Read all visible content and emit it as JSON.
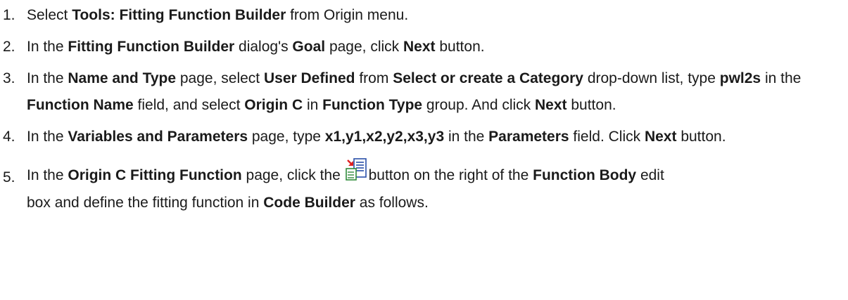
{
  "steps": [
    {
      "number": "1.",
      "parts": [
        {
          "t": "Select "
        },
        {
          "b": "Tools: Fitting Function Builder"
        },
        {
          "t": " from Origin menu."
        }
      ]
    },
    {
      "number": "2.",
      "parts": [
        {
          "t": "In the "
        },
        {
          "b": "Fitting Function Builder"
        },
        {
          "t": " dialog's "
        },
        {
          "b": "Goal"
        },
        {
          "t": " page, click "
        },
        {
          "b": "Next"
        },
        {
          "t": " button."
        }
      ]
    },
    {
      "number": "3.",
      "parts": [
        {
          "t": "In the "
        },
        {
          "b": "Name and Type"
        },
        {
          "t": " page, select "
        },
        {
          "b": "User Defined"
        },
        {
          "t": " from "
        },
        {
          "b": "Select or create a Category"
        },
        {
          "t": " drop-down list, type "
        },
        {
          "b": "pwl2s"
        },
        {
          "t": " in the "
        },
        {
          "b": "Function Name"
        },
        {
          "t": " field, and select "
        },
        {
          "b": "Origin C"
        },
        {
          "t": " in "
        },
        {
          "b": "Function Type"
        },
        {
          "t": " group. And click "
        },
        {
          "b": "Next"
        },
        {
          "t": " button."
        }
      ]
    },
    {
      "number": "4.",
      "parts": [
        {
          "t": "In the "
        },
        {
          "b": "Variables and Parameters"
        },
        {
          "t": " page, type "
        },
        {
          "b": "x1,y1,x2,y2,x3,y3"
        },
        {
          "t": " in the "
        },
        {
          "b": "Parameters"
        },
        {
          "t": " field. Click "
        },
        {
          "b": "Next"
        },
        {
          "t": " button."
        }
      ]
    }
  ],
  "step5": {
    "number": "5.",
    "before_button": [
      {
        "t": "In the "
      },
      {
        "b": "Origin C Fitting Function"
      },
      {
        "t": " page, click the "
      }
    ],
    "button_icon": "code-builder-icon",
    "after_button": [
      {
        "t": "button on the right of the "
      },
      {
        "b": "Function Body"
      },
      {
        "t": " edit"
      }
    ],
    "line2": [
      {
        "t": "box and define the fitting function in "
      },
      {
        "b": "Code Builder"
      },
      {
        "t": " as follows."
      }
    ]
  },
  "colors": {
    "text": "#1a1a1a",
    "icon_red": "#e02020",
    "icon_blue": "#2a4fa8",
    "icon_green": "#2f8a3a"
  }
}
